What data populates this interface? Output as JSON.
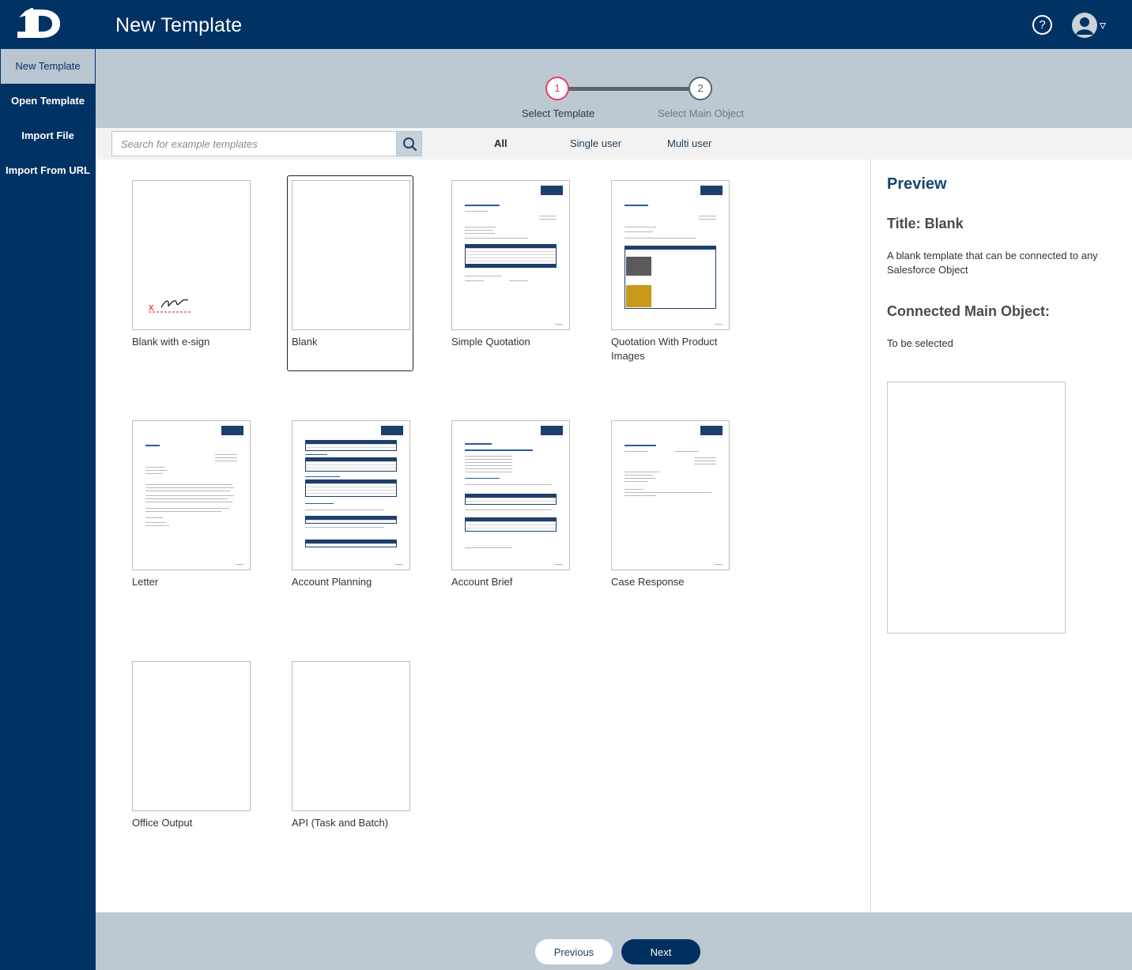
{
  "header": {
    "title": "New Template",
    "help_icon_glyph": "?",
    "caret_glyph": "▿"
  },
  "sidebar": {
    "items": [
      {
        "label": "New Template",
        "active": true
      },
      {
        "label": "Open Template"
      },
      {
        "label": "Import File"
      },
      {
        "label": "Import From URL"
      }
    ]
  },
  "stepper": {
    "steps": [
      {
        "number": "1",
        "label": "Select Template",
        "state": "current"
      },
      {
        "number": "2",
        "label": "Select Main Object",
        "state": "pending"
      }
    ]
  },
  "filter": {
    "search_placeholder": "Search for example templates",
    "search_value": "",
    "tabs": [
      {
        "label": "All",
        "active": true
      },
      {
        "label": "Single user"
      },
      {
        "label": "Multi user"
      }
    ]
  },
  "templates": [
    {
      "label": "Blank with e-sign"
    },
    {
      "label": "Blank",
      "selected": true
    },
    {
      "label": "Simple Quotation"
    },
    {
      "label": "Quotation With Product Images"
    },
    {
      "label": "Letter"
    },
    {
      "label": "Account Planning"
    },
    {
      "label": "Account Brief"
    },
    {
      "label": "Case Response"
    },
    {
      "label": "Office Output"
    },
    {
      "label": "API (Task and Batch)"
    }
  ],
  "preview": {
    "heading": "Preview",
    "title": "Title: Blank",
    "description": "A blank template that can be connected to any Salesforce Object",
    "connected_heading": "Connected Main Object:",
    "connected_value": "To be selected"
  },
  "footer": {
    "previous_label": "Previous",
    "next_label": "Next"
  },
  "colors": {
    "navy": "#003263",
    "step_active": "#e83b6d",
    "panel_gray": "#bdc9d2"
  }
}
